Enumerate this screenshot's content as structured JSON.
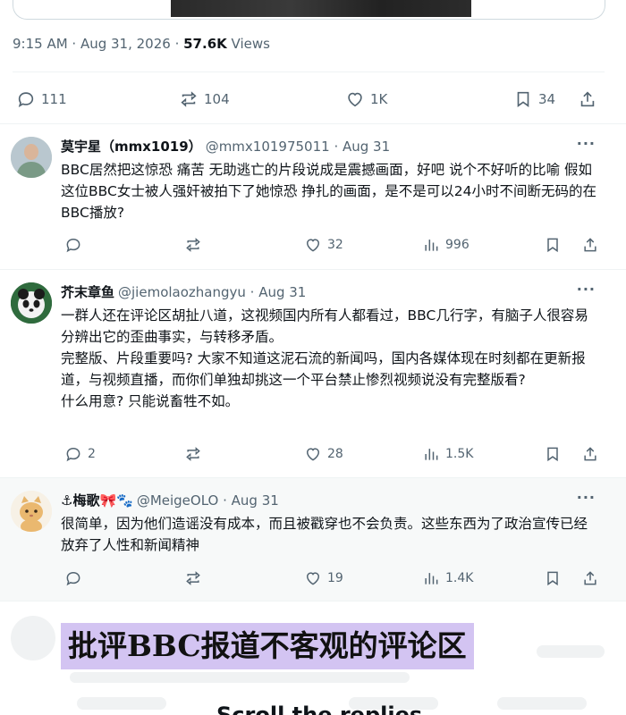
{
  "post": {
    "time": "9:15 AM · Aug 31, 2026 · ",
    "views_count": "57.6K",
    "views_label": " Views",
    "stats": {
      "replies": "111",
      "reposts": "104",
      "likes": "1K",
      "bookmarks": "34"
    }
  },
  "replies": [
    {
      "name": "莫宇星（mmx1019）",
      "meta": "@mmx101975011 · Aug 31",
      "text": [
        "BBC居然把这惊恐 痛苦 无助逃亡的片段说成是震撼画面，好吧 说个不好听的比喻 假如这位BBC女士被人强奸被拍下了她惊恐 挣扎的画面，是不是可以24小时不间断无码的在BBC播放?"
      ],
      "replies": "",
      "reposts": "",
      "likes": "32",
      "views": "996"
    },
    {
      "name": "芥末章鱼",
      "meta": "@jiemolaozhangyu · Aug 31",
      "text": [
        "一群人还在评论区胡扯八道，这视频国内所有人都看过，BBC几行字，有脑子人很容易分辨出它的歪曲事实，与转移矛盾。",
        "完整版、片段重要吗? 大家不知道这泥石流的新闻吗，国内各媒体现在时刻都在更新报道，与视频直播，而你们单独却挑这一个平台禁止惨烈视频说没有完整版看?",
        "什么用意? 只能说畜牲不如。"
      ],
      "replies": "2",
      "reposts": "",
      "likes": "28",
      "views": "1.5K"
    },
    {
      "name": "⚓梅歌🎀🐾",
      "meta": "@MeigeOLO · Aug 31",
      "text": [
        "很简单，因为他们造谣没有成本，而且被戳穿也不会负责。这些东西为了政治宣传已经放弃了人性和新闻精神"
      ],
      "replies": "",
      "reposts": "",
      "likes": "19",
      "views": "1.4K"
    }
  ],
  "overlay_caption": "批评BBC报道不客观的评论区",
  "scroll_text": "Scroll the replies"
}
